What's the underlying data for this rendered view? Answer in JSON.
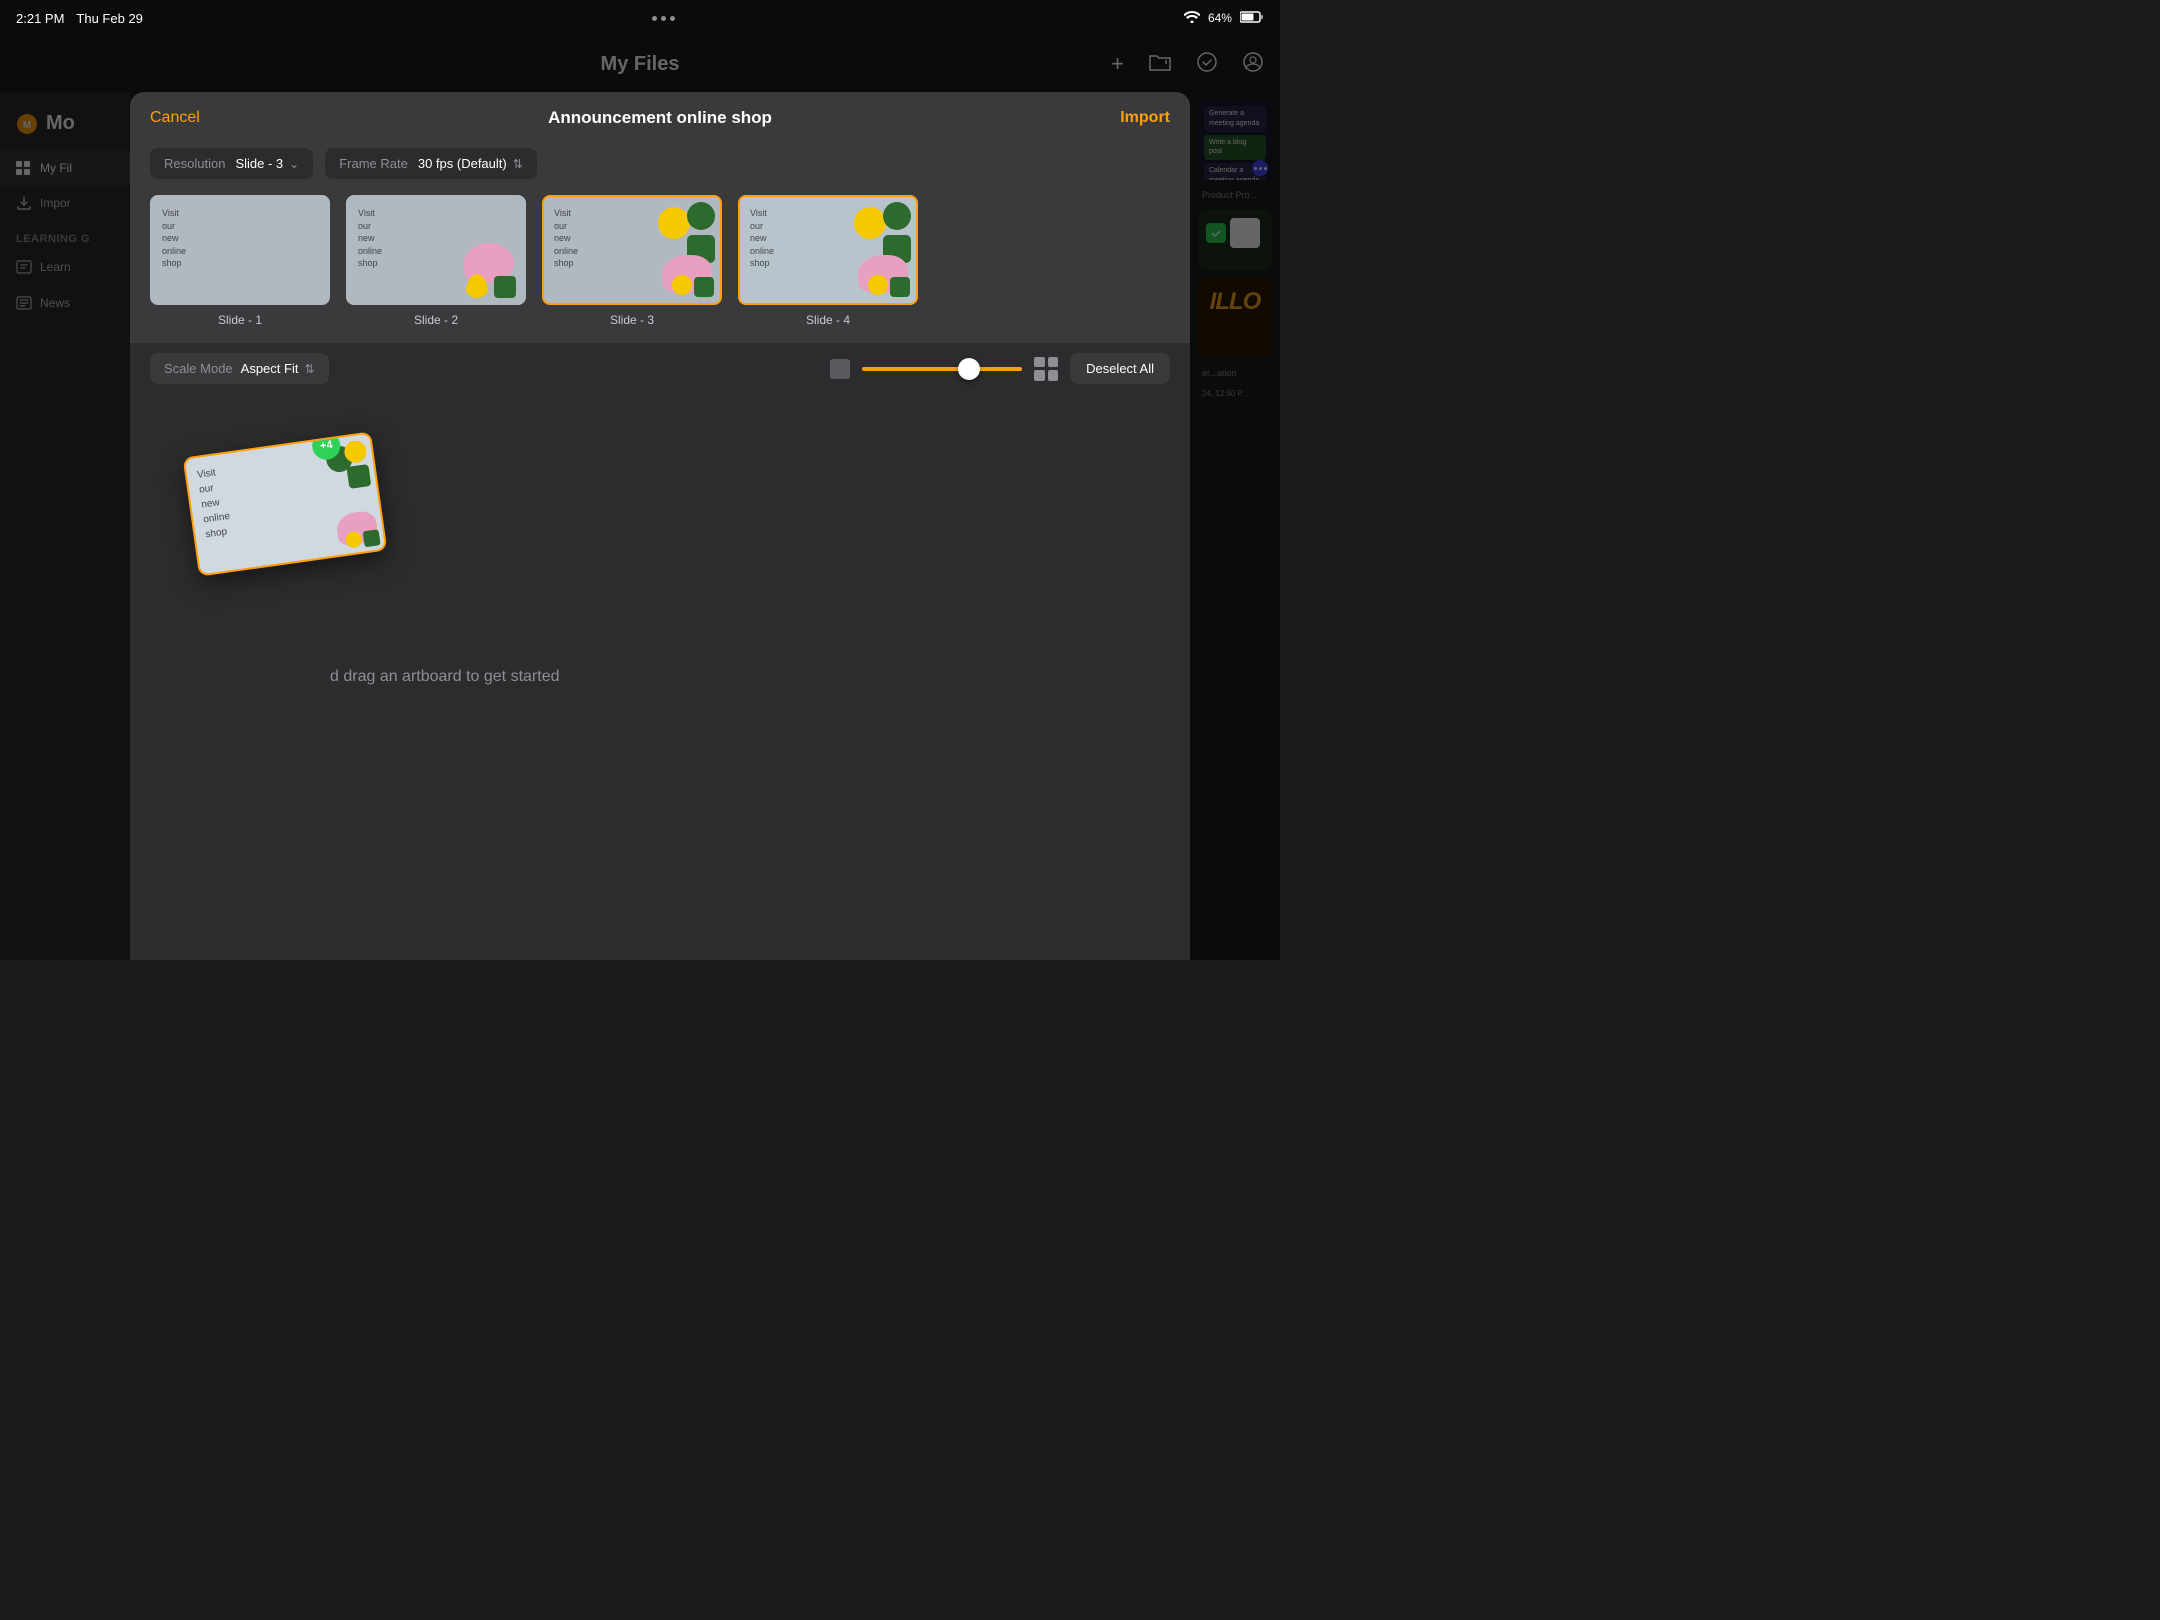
{
  "statusBar": {
    "time": "2:21 PM",
    "date": "Thu Feb 29",
    "wifi": "wifi",
    "battery": "64%"
  },
  "appTitle": "My Files",
  "modal": {
    "title": "Announcement online shop",
    "cancelLabel": "Cancel",
    "importLabel": "Import",
    "resolutionLabel": "Resolution",
    "resolutionValue": "Slide - 3",
    "frameRateLabel": "Frame Rate",
    "frameRateValue": "30 fps (Default)",
    "slides": [
      {
        "label": "Slide - 1",
        "text": "Visit\nour\nnew\nonline\nshop"
      },
      {
        "label": "Slide - 2",
        "text": "Visit\nour\nnew\nonline\nshop"
      },
      {
        "label": "Slide - 3",
        "text": "Visit\nour\nnew\nonline\nshop"
      },
      {
        "label": "Slide - 4",
        "text": "Visit\nour\nnew\nonline\nshop"
      }
    ],
    "scaleMode": "Scale Mode",
    "scaleModeValue": "Aspect Fit",
    "deselectAllLabel": "Deselect All",
    "dropHint": "d drag an artboard to get started",
    "dragBadge": "+4"
  },
  "sidebar": {
    "logoText": "Mo",
    "items": [
      {
        "label": "My Fil",
        "icon": "grid-icon"
      },
      {
        "label": "Impor",
        "icon": "import-icon"
      },
      {
        "sectionLabel": "Learning G"
      },
      {
        "label": "Learn",
        "icon": "learn-icon"
      },
      {
        "label": "News",
        "icon": "news-icon"
      }
    ]
  }
}
